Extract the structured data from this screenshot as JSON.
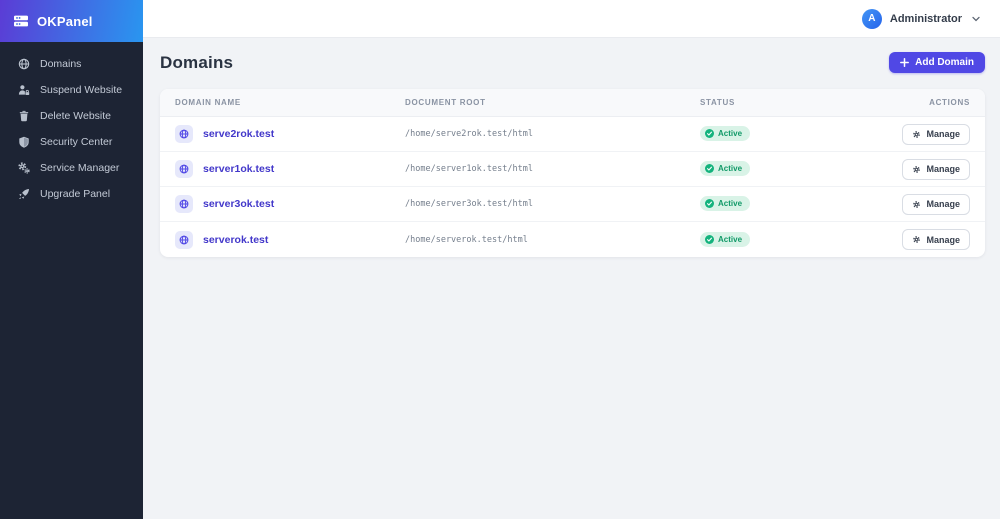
{
  "app": {
    "name": "OKPanel",
    "logo_icon": "server-icon"
  },
  "topbar": {
    "user": {
      "initial": "A",
      "name": "Administrator",
      "menu_icon": "chevron-down-icon"
    }
  },
  "sidebar": {
    "items": [
      {
        "label": "Domains",
        "icon": "globe-icon"
      },
      {
        "label": "Suspend Website",
        "icon": "user-lock-icon"
      },
      {
        "label": "Delete Website",
        "icon": "trash-icon"
      },
      {
        "label": "Security Center",
        "icon": "shield-icon"
      },
      {
        "label": "Service Manager",
        "icon": "gears-icon"
      },
      {
        "label": "Upgrade Panel",
        "icon": "rocket-icon"
      }
    ]
  },
  "main": {
    "title": "Domains",
    "add_button": {
      "label": "Add Domain",
      "icon": "plus-icon"
    },
    "table": {
      "headers": [
        "Domain Name",
        "Document Root",
        "Status",
        "Actions"
      ],
      "rows": [
        {
          "domain": "serve2rok.test",
          "root": "/home/serve2rok.test/html",
          "status": "Active",
          "action": "Manage"
        },
        {
          "domain": "server1ok.test",
          "root": "/home/server1ok.test/html",
          "status": "Active",
          "action": "Manage"
        },
        {
          "domain": "server3ok.test",
          "root": "/home/server3ok.test/html",
          "status": "Active",
          "action": "Manage"
        },
        {
          "domain": "serverok.test",
          "root": "/home/serverok.test/html",
          "status": "Active",
          "action": "Manage"
        }
      ]
    }
  },
  "colors": {
    "sidebar_bg": "#1d2434",
    "brand_gradient_start": "#5b3cd5",
    "brand_gradient_end": "#2996f0",
    "accent": "#5048e5",
    "domain_link": "#4338ca",
    "status_active_bg": "#d9f3e7",
    "status_active_text": "#119a68",
    "content_bg": "#f1f3f6"
  }
}
